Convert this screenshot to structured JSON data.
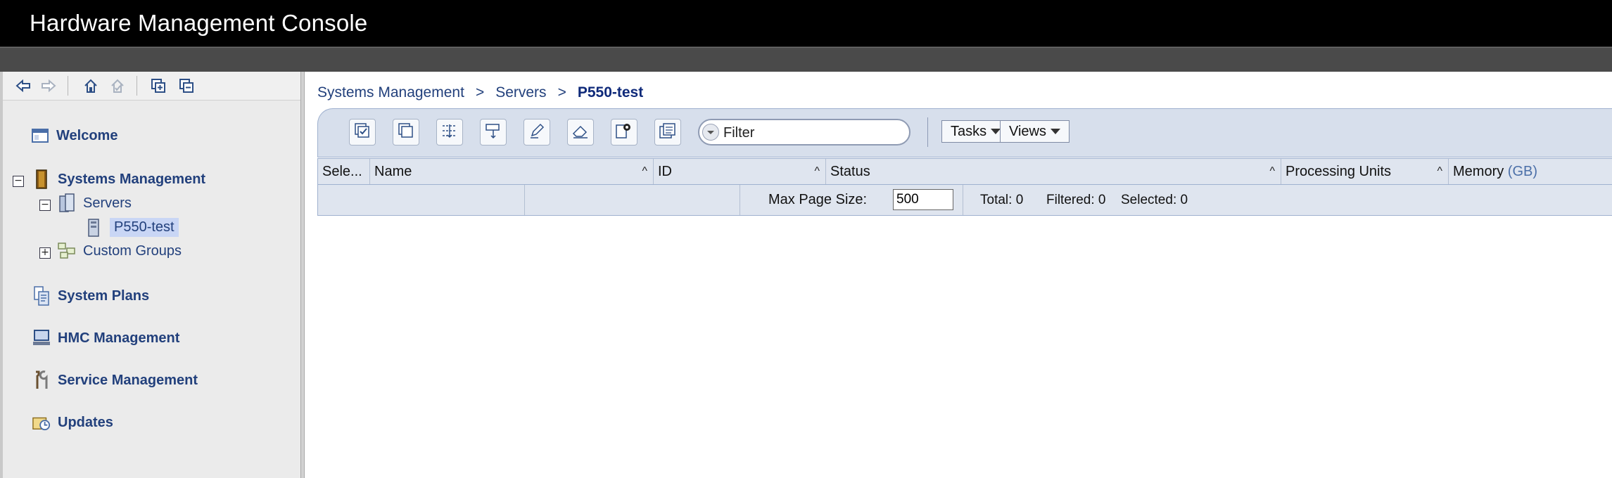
{
  "header": {
    "title": "Hardware Management Console"
  },
  "nav_toolbar": {
    "icons": [
      "back-icon",
      "forward-icon",
      "home-icon",
      "favorite-icon",
      "expand-all-icon",
      "collapse-all-icon"
    ]
  },
  "nav": {
    "welcome": "Welcome",
    "systems_management": "Systems Management",
    "servers": "Servers",
    "selected_server": "P550-test",
    "custom_groups": "Custom Groups",
    "system_plans": "System Plans",
    "hmc_management": "HMC Management",
    "service_management": "Service Management",
    "updates": "Updates"
  },
  "breadcrumb": {
    "items": [
      "Systems Management",
      "Servers",
      "P550-test"
    ],
    "separator": ">"
  },
  "toolbar": {
    "filter_placeholder": "Filter",
    "filter_value": "Filter",
    "tasks_label": "Tasks",
    "views_label": "Views"
  },
  "table": {
    "columns": [
      "Sele...",
      "Name",
      "ID",
      "Status",
      "Processing Units",
      "Memory"
    ],
    "memory_unit": "(GB)",
    "rows": []
  },
  "footer": {
    "max_page_size_label": "Max Page Size:",
    "max_page_size_value": "500",
    "total": "Total: 0",
    "filtered": "Filtered: 0",
    "selected": "Selected: 0"
  },
  "colors": {
    "header_bg": "#000000",
    "nav_link": "#22407c",
    "toolbar_bg": "#d7dfec"
  }
}
